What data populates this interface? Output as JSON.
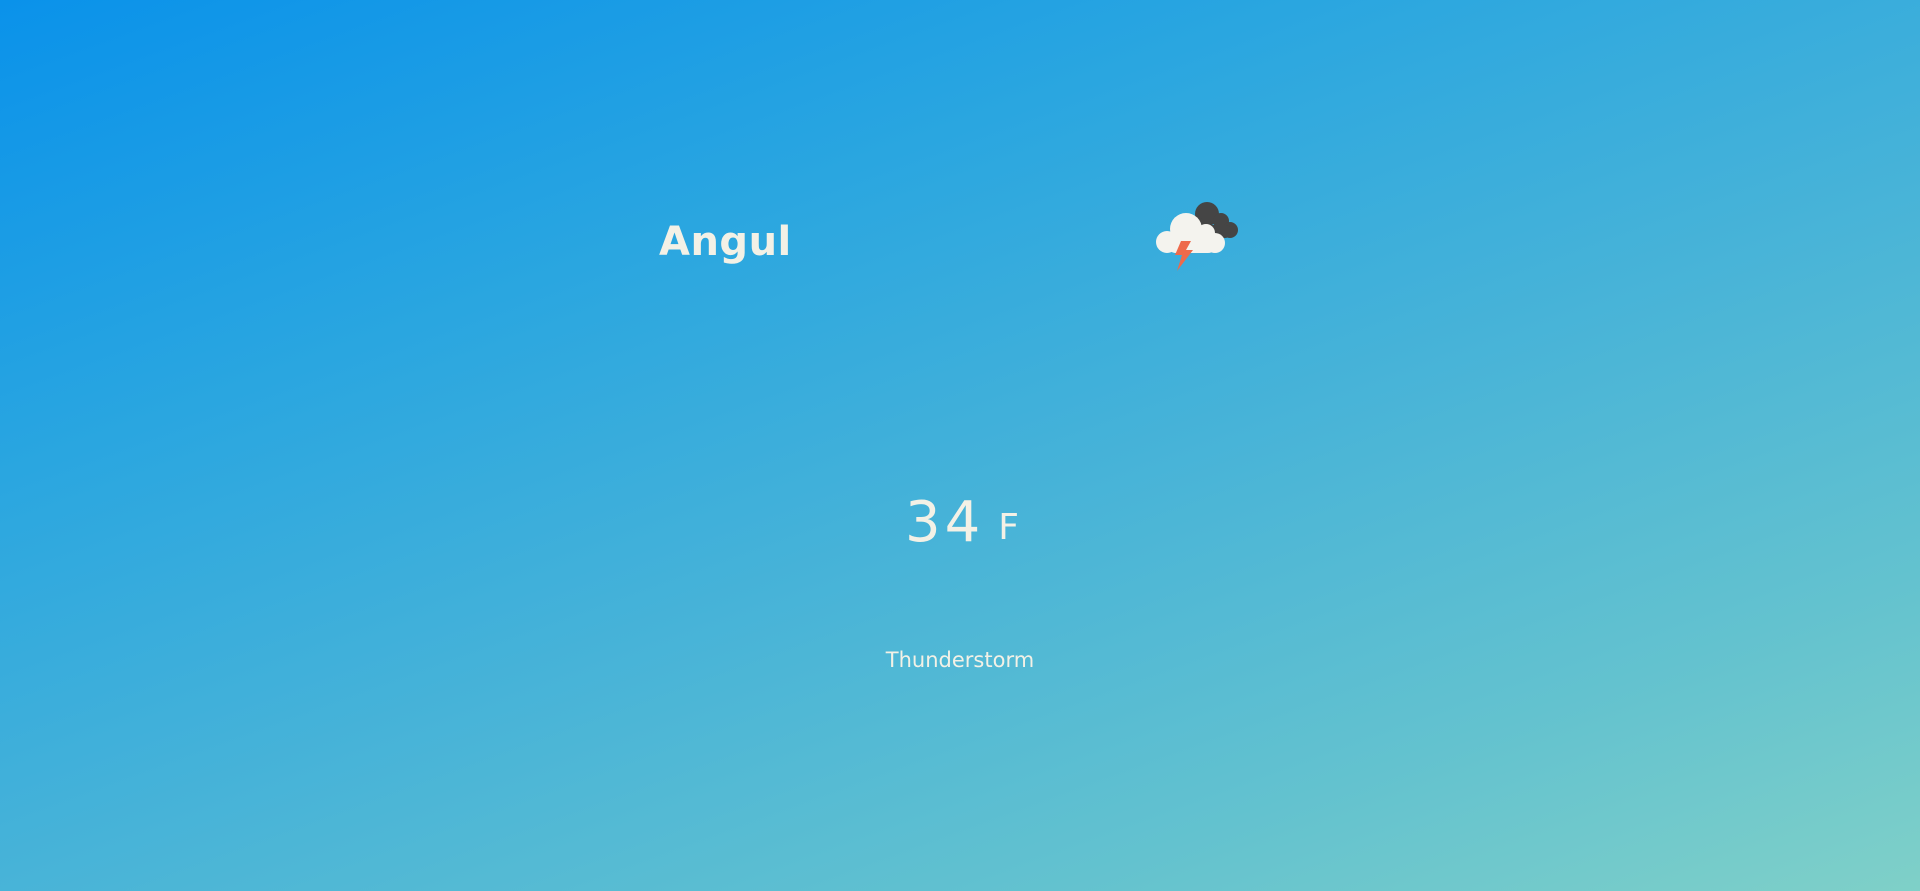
{
  "weather": {
    "city": "Angul",
    "icon": "thunderstorm-icon",
    "temperature": "34",
    "unit": "F",
    "condition": "Thunderstorm"
  },
  "colors": {
    "gradient_start": "#0a92ea",
    "gradient_end": "#7fd0c8",
    "text": "#f3f1e6",
    "dark_cloud": "#454545",
    "light_cloud": "#f4f3ee",
    "lightning": "#ee6a4b"
  }
}
